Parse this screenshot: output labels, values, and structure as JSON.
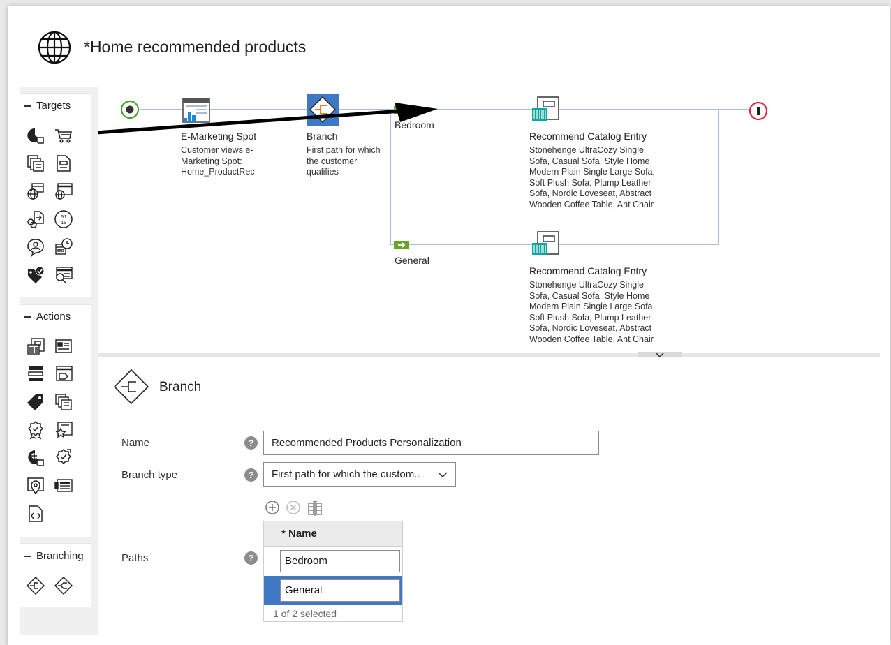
{
  "page": {
    "title": "*Home recommended products",
    "title_icon": "globe-icon"
  },
  "palette": {
    "targets": {
      "heading": "Targets",
      "icons": [
        "customer-segment-icon",
        "shopping-cart-icon",
        "catalog-browsing-icon",
        "catalog-entry-icon",
        "online-behavior-icon",
        "web-activity-icon",
        "external-site-referral-icon",
        "social-commerce-icon",
        "customer-participates-icon",
        "day-time-icon",
        "purchase-history-icon",
        "search-criteria-icon"
      ]
    },
    "actions": {
      "heading": "Actions",
      "icons": [
        "recommend-catalog-entry-icon",
        "recommend-content-icon",
        "display-category-icon",
        "display-promotion-icon",
        "apply-tag-icon",
        "add-to-segment-icon",
        "reward-icon",
        "star-rating-icon",
        "add-customer-icon",
        "issue-coupon-icon",
        "location-icon",
        "display-banner-icon",
        "execute-code-icon"
      ]
    },
    "branching": {
      "heading": "Branching",
      "icons": [
        "branch-icon",
        "experiment-icon"
      ]
    }
  },
  "flow": {
    "nodes": [
      {
        "title": "E-Marketing Spot",
        "description": "Customer views e-Marketing Spot: Home_ProductRec",
        "icon": "e-marketing-spot-icon"
      },
      {
        "title": "Branch",
        "description": "First path for which the customer qualifies",
        "icon": "branch-icon"
      },
      {
        "title": "Recommend Catalog Entry",
        "description": "Stonehenge UltraCozy Single Sofa, Casual Sofa, Style Home Modern Plain Single Large Sofa, Soft Plush Sofa, Plump Leather Sofa, Nordic Loveseat, Abstract Wooden Coffee Table, Ant Chair",
        "icon": "recommend-catalog-entry-icon"
      },
      {
        "title": "Recommend Catalog Entry",
        "description": "Stonehenge UltraCozy Single Sofa, Casual Sofa, Style Home Modern Plain Single Large Sofa, Soft Plush Sofa, Plump Leather Sofa, Nordic Loveseat, Abstract Wooden Coffee Table, Ant Chair",
        "icon": "recommend-catalog-entry-icon"
      }
    ],
    "paths": [
      {
        "label": "Bedroom"
      },
      {
        "label": "General"
      }
    ],
    "colors": {
      "line": "#a9bddc",
      "branch_selected": "#3f78c5",
      "start": "#4aa02c",
      "end": "#e0243a",
      "path_flag": "#6aa22a"
    }
  },
  "properties": {
    "heading": "Branch",
    "name": {
      "label": "Name",
      "value": "Recommended Products Personalization"
    },
    "branch_type": {
      "label": "Branch type",
      "value": "First path for which the custom.."
    },
    "paths": {
      "label": "Paths",
      "column_header": "* Name",
      "rows": [
        "Bedroom",
        "General"
      ],
      "selected_row": 1,
      "footer": "1 of 2 selected"
    },
    "toolbar_icons": [
      "add-icon",
      "remove-icon",
      "column-config-icon"
    ]
  }
}
